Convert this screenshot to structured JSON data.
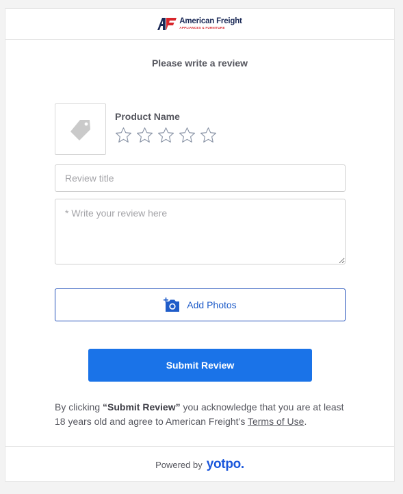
{
  "brand": {
    "name": "American Freight",
    "tagline": "APPLIANCES & FURNITURE",
    "mark_text": "AF",
    "colors": {
      "navy": "#1b2a57",
      "red": "#d8262c"
    }
  },
  "form": {
    "subtitle": "Please write a review",
    "product": {
      "name": "Product Name",
      "image_icon": "tag-icon",
      "rating": 0,
      "max_rating": 5
    },
    "title_input": {
      "value": "",
      "placeholder": "Review title"
    },
    "body_input": {
      "value": "",
      "placeholder": "* Write your review here"
    },
    "add_photos": {
      "label": "Add Photos",
      "icon": "camera-plus-icon"
    },
    "submit": {
      "label": "Submit Review"
    }
  },
  "legal": {
    "prefix": "By clicking ",
    "bold": "“Submit Review”",
    "middle": " you acknowledge that you are at least 18 years old and agree to American Freight’s ",
    "link": "Terms of Use",
    "suffix": "."
  },
  "footer": {
    "powered_by": "Powered by",
    "provider": "yotpo."
  },
  "colors": {
    "accent": "#1a73e8",
    "outline_blue": "#1f4db8"
  }
}
